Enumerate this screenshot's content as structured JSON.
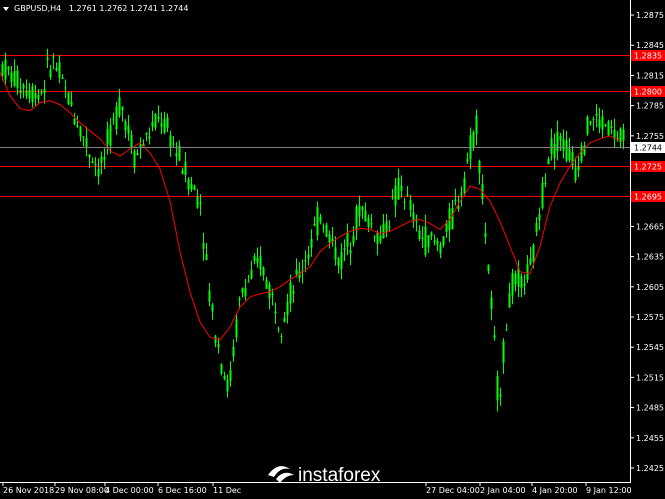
{
  "header": {
    "symbol_label": "GBPUSD,H4",
    "ohlc_text": "1.2761 1.2762 1.2741 1.2744",
    "menu_icon": "triangle-down-icon"
  },
  "price_tags": {
    "current": "1.2744",
    "levels": [
      "1.2835",
      "1.2800",
      "1.2725",
      "1.2695"
    ]
  },
  "watermark": {
    "text": "instaforex",
    "icon": "instaforex-logo-icon"
  },
  "colors": {
    "background": "#000000",
    "candle": "#00ff00",
    "ma_line": "#ff0000",
    "level_line": "#ff0000",
    "level_tag": "#ff0000",
    "current_price_tag": "#ffffff",
    "axis": "#ffffff"
  },
  "chart_data": {
    "type": "candlestick",
    "symbol": "GBPUSD",
    "timeframe": "H4",
    "y_ticks": [
      "1.2875",
      "1.2845",
      "1.2815",
      "1.2785",
      "1.2755",
      "1.2725",
      "1.2695",
      "1.2665",
      "1.2635",
      "1.2605",
      "1.2575",
      "1.2545",
      "1.2515",
      "1.2485",
      "1.2455",
      "1.2425"
    ],
    "ylim": [
      1.2418,
      1.2882
    ],
    "x_ticks": [
      "26 Nov 2018",
      "29 Nov 08:00",
      "4 Dec 00:00",
      "6 Dec 16:00",
      "11 Dec",
      "27 Dec 04:00",
      "2 Jan 04:00",
      "4 Jan 20:00",
      "9 Jan 12:00"
    ],
    "horizontal_levels": [
      1.2835,
      1.28,
      1.2725,
      1.2695
    ],
    "current_price": 1.2744,
    "moving_average": [
      [
        0,
        1.2818
      ],
      [
        10,
        1.2795
      ],
      [
        20,
        1.2782
      ],
      [
        30,
        1.278
      ],
      [
        40,
        1.2788
      ],
      [
        50,
        1.279
      ],
      [
        60,
        1.2786
      ],
      [
        70,
        1.2778
      ],
      [
        80,
        1.2768
      ],
      [
        90,
        1.276
      ],
      [
        100,
        1.2752
      ],
      [
        110,
        1.274
      ],
      [
        120,
        1.2735
      ],
      [
        130,
        1.2742
      ],
      [
        140,
        1.2748
      ],
      [
        150,
        1.2738
      ],
      [
        160,
        1.2722
      ],
      [
        170,
        1.269
      ],
      [
        180,
        1.264
      ],
      [
        190,
        1.26
      ],
      [
        200,
        1.257
      ],
      [
        210,
        1.2555
      ],
      [
        220,
        1.2552
      ],
      [
        230,
        1.2565
      ],
      [
        240,
        1.2585
      ],
      [
        250,
        1.2595
      ],
      [
        260,
        1.2598
      ],
      [
        270,
        1.26
      ],
      [
        280,
        1.2605
      ],
      [
        290,
        1.2612
      ],
      [
        300,
        1.2618
      ],
      [
        310,
        1.2625
      ],
      [
        320,
        1.264
      ],
      [
        330,
        1.2648
      ],
      [
        340,
        1.2655
      ],
      [
        350,
        1.266
      ],
      [
        360,
        1.2663
      ],
      [
        370,
        1.2662
      ],
      [
        380,
        1.2658
      ],
      [
        390,
        1.266
      ],
      [
        400,
        1.2665
      ],
      [
        410,
        1.267
      ],
      [
        420,
        1.2672
      ],
      [
        430,
        1.2668
      ],
      [
        440,
        1.2662
      ],
      [
        450,
        1.2672
      ],
      [
        460,
        1.269
      ],
      [
        470,
        1.2705
      ],
      [
        480,
        1.2702
      ],
      [
        490,
        1.269
      ],
      [
        500,
        1.267
      ],
      [
        510,
        1.2645
      ],
      [
        520,
        1.262
      ],
      [
        530,
        1.2618
      ],
      [
        540,
        1.2645
      ],
      [
        550,
        1.2685
      ],
      [
        560,
        1.2708
      ],
      [
        570,
        1.2725
      ],
      [
        580,
        1.2738
      ],
      [
        590,
        1.2748
      ],
      [
        600,
        1.2752
      ],
      [
        610,
        1.2755
      ],
      [
        620,
        1.275
      ]
    ]
  }
}
